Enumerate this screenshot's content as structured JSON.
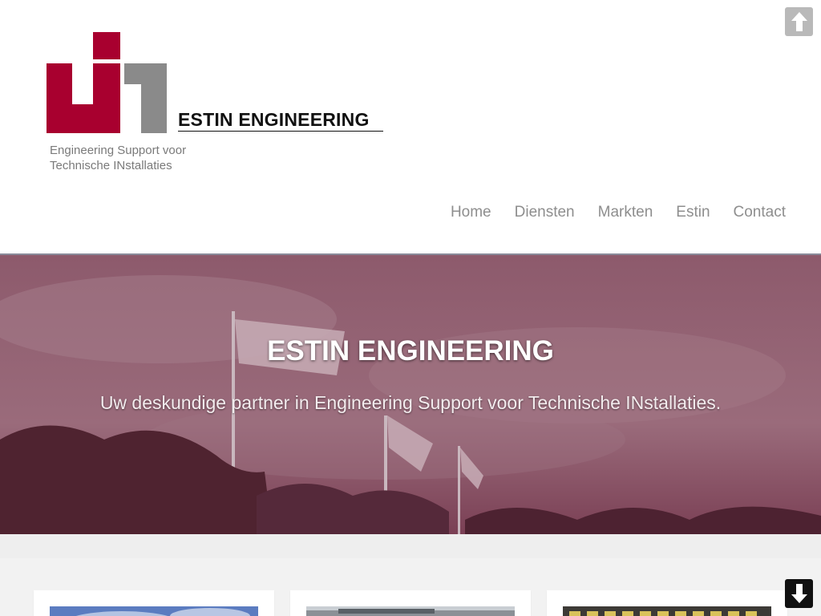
{
  "logo": {
    "title": "ESTIN ENGINEERING",
    "tagline_line1": "Engineering Support voor",
    "tagline_line2": "Technische INstallaties",
    "colors": {
      "crimson": "#a8002f",
      "gray": "#8a8a8a"
    }
  },
  "nav": {
    "items": [
      {
        "label": "Home"
      },
      {
        "label": "Diensten"
      },
      {
        "label": "Markten"
      },
      {
        "label": "Estin"
      },
      {
        "label": "Contact"
      }
    ]
  },
  "controls": {
    "scroll_up_icon": "arrow-up-icon",
    "scroll_down_icon": "arrow-down-icon"
  },
  "hero": {
    "title": "ESTIN ENGINEERING",
    "subtitle": "Uw deskundige partner in Engineering Support voor Technische INstallaties.",
    "overlay_color": "#8b3a57"
  },
  "cards": [
    {
      "image": "sky-photo"
    },
    {
      "image": "landscape-photo"
    },
    {
      "image": "building-photo"
    }
  ]
}
